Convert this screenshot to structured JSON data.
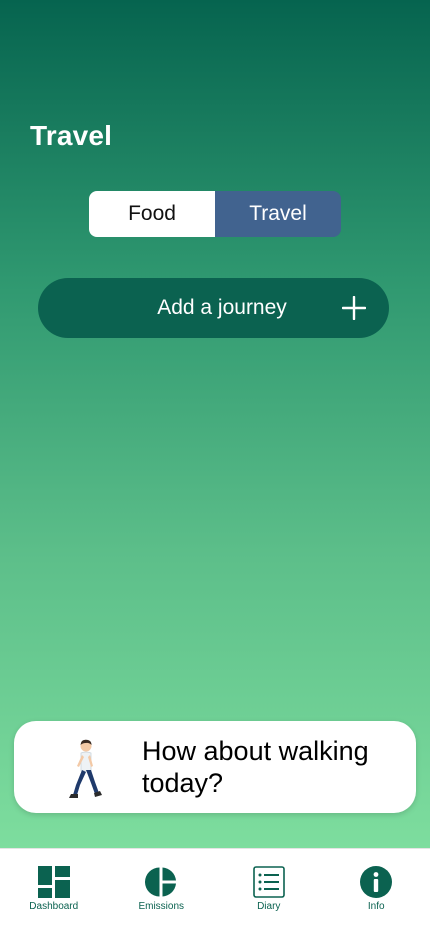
{
  "page": {
    "title": "Travel"
  },
  "segmented": {
    "options": [
      "Food",
      "Travel"
    ],
    "selected": "Travel"
  },
  "add_journey": {
    "label": "Add a journey",
    "icon": "plus-icon"
  },
  "tip": {
    "icon": "person-walking-icon",
    "text": "How about walking today?"
  },
  "tabbar": {
    "items": [
      {
        "label": "Dashboard",
        "icon": "dashboard-icon"
      },
      {
        "label": "Emissions",
        "icon": "pie-chart-icon"
      },
      {
        "label": "Diary",
        "icon": "list-icon"
      },
      {
        "label": "Info",
        "icon": "info-icon"
      }
    ]
  },
  "colors": {
    "accent": "#0b6250",
    "segment_selected": "#41638f",
    "gradient_top": "#06644f",
    "gradient_bottom": "#87e6a4"
  }
}
